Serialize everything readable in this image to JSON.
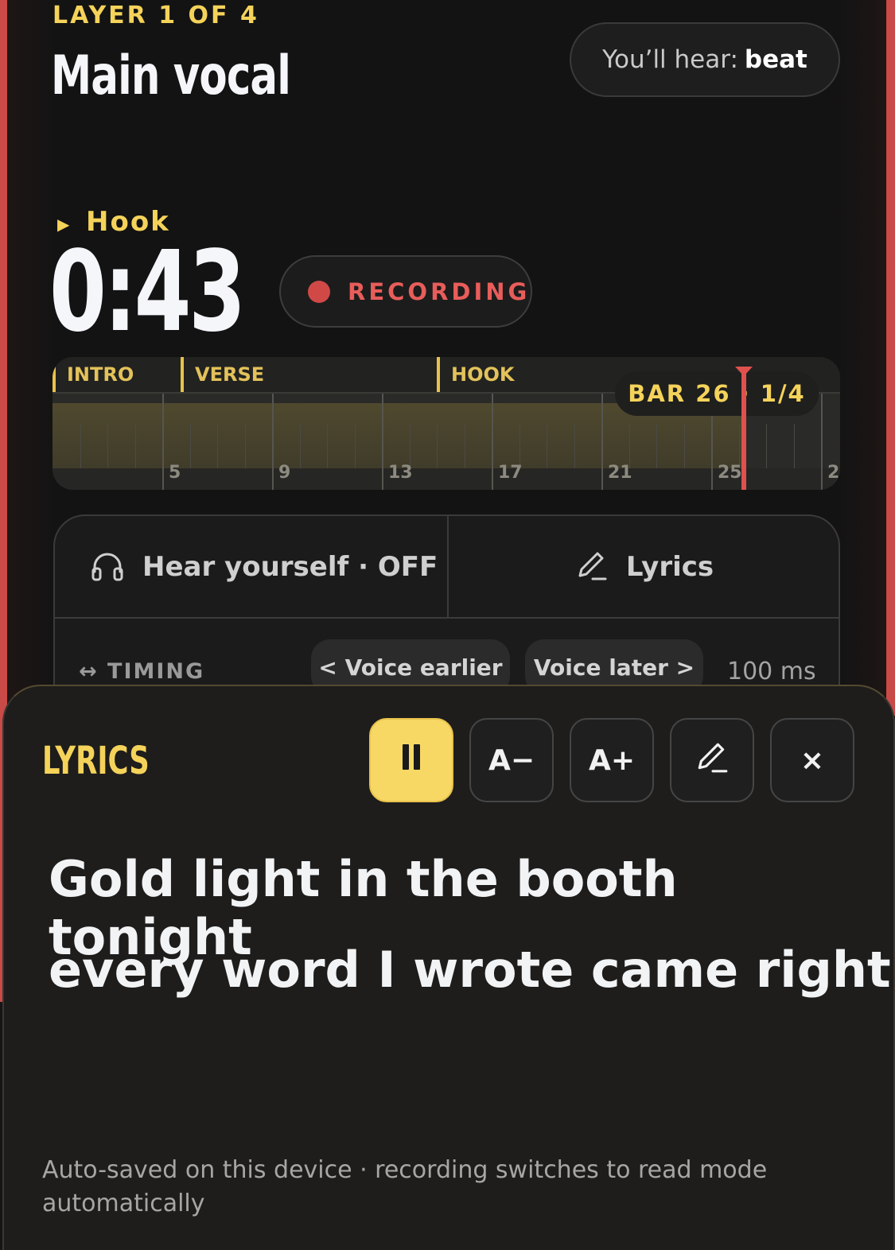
{
  "header": {
    "layer_label": "LAYER 1 OF 4",
    "title": "Main vocal",
    "hear_prefix": "You’ll hear:",
    "hear_value": "beat"
  },
  "status": {
    "section": "Hook",
    "time": "0:43",
    "recording_label": "RECORDING"
  },
  "timeline": {
    "sections": [
      "INTRO",
      "VERSE",
      "HOOK"
    ],
    "bar_numbers": [
      "5",
      "9",
      "13",
      "17",
      "21",
      "25",
      "2"
    ],
    "position_label": "BAR 26 · 1/4"
  },
  "controls": {
    "hear_yourself": "Hear yourself · OFF",
    "lyrics": "Lyrics",
    "timing_label": "↔ TIMING",
    "voice_earlier": "< Voice earlier",
    "voice_later": "Voice later >",
    "offset": "100 ms"
  },
  "lyrics_sheet": {
    "title": "LYRICS",
    "font_smaller": "A−",
    "font_larger": "A+",
    "close": "×",
    "lines": [
      "Gold light in the booth tonight",
      "every word I wrote came right"
    ],
    "footnote": "Auto-saved on this device · recording switches to read mode automatically"
  },
  "colors": {
    "accent": "#f5d35a",
    "recording": "#e85d5a",
    "frame_red": "#c94a47"
  },
  "icons": {
    "hear_yourself": "headphones-icon",
    "lyrics": "pencil-icon",
    "pause": "pause-icon",
    "edit": "pencil-icon",
    "close": "close-icon"
  }
}
